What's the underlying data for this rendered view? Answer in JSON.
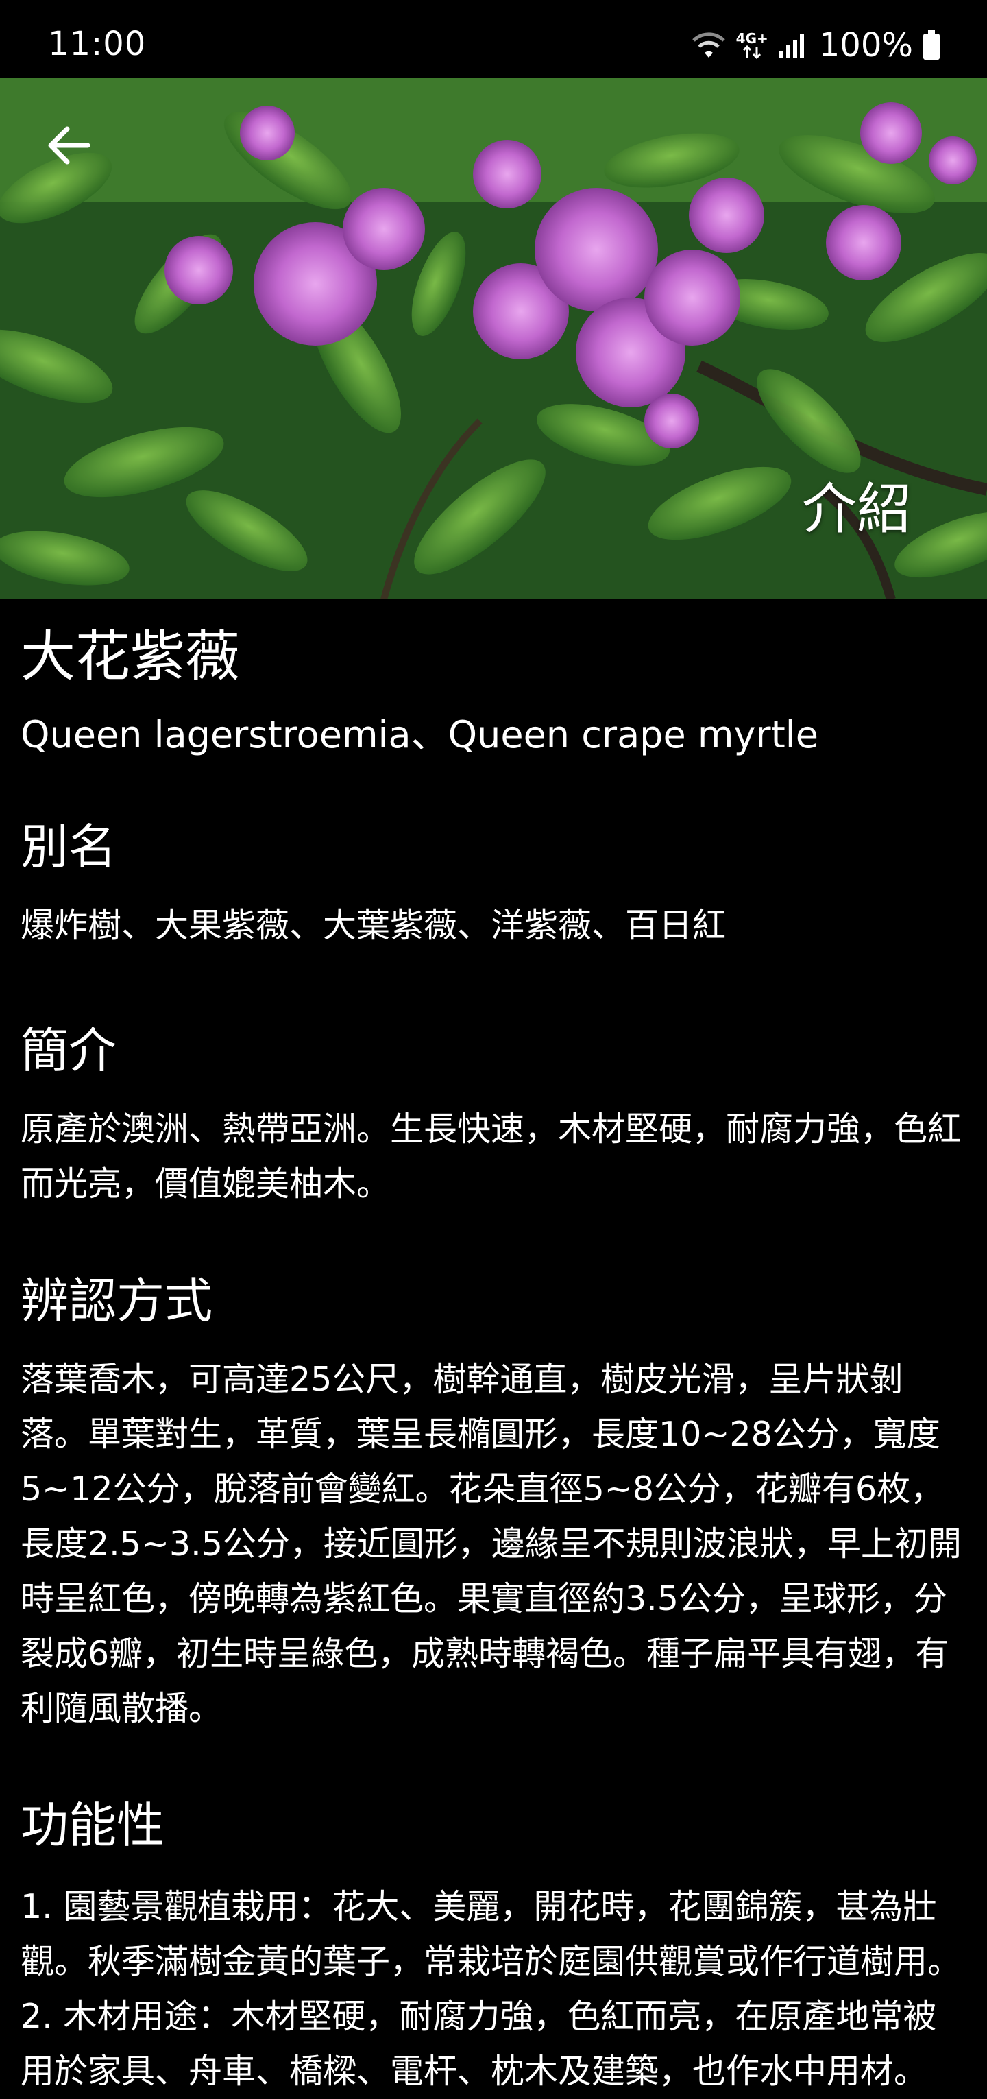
{
  "status_bar": {
    "time": "11:00",
    "network": "4G+",
    "battery": "100%"
  },
  "hero": {
    "label": "介紹",
    "icons": {
      "back": "arrow-left-icon"
    }
  },
  "plant": {
    "name": "大花紫薇",
    "english_name": "Queen lagerstroemia、Queen crape myrtle"
  },
  "sections": {
    "alias": {
      "title": "別名",
      "body": "爆炸樹、大果紫薇、大葉紫薇、洋紫薇、百日紅"
    },
    "intro": {
      "title": "簡介",
      "body": "原產於澳洲、熱帶亞洲。生長快速，木材堅硬，耐腐力強，色紅而光亮，價值媲美柚木。"
    },
    "identification": {
      "title": "辨認方式",
      "body": "落葉喬木，可高達25公尺，樹幹通直，樹皮光滑，呈片狀剝落。單葉對生，革質，葉呈長橢圓形，長度10~28公分，寬度5~12公分，脫落前會變紅。花朵直徑5~8公分，花瓣有6枚，長度2.5~3.5公分，接近圓形，邊緣呈不規則波浪狀，早上初開時呈紅色，傍晚轉為紫紅色。果實直徑約3.5公分，呈球形，分裂成6瓣，初生時呈綠色，成熟時轉褐色。種子扁平具有翅，有利隨風散播。"
    },
    "function": {
      "title": "功能性",
      "items": [
        "1. 園藝景觀植栽用：花大、美麗，開花時，花團錦簇，甚為壯觀。秋季滿樹金黃的葉子，常栽培於庭園供觀賞或作行道樹用。",
        "2. 木材用途：木材堅硬，耐腐力強，色紅而亮，在原產地常被用於家具、舟車、橋樑、電杆、枕木及建築，也作水中用材。"
      ]
    }
  }
}
